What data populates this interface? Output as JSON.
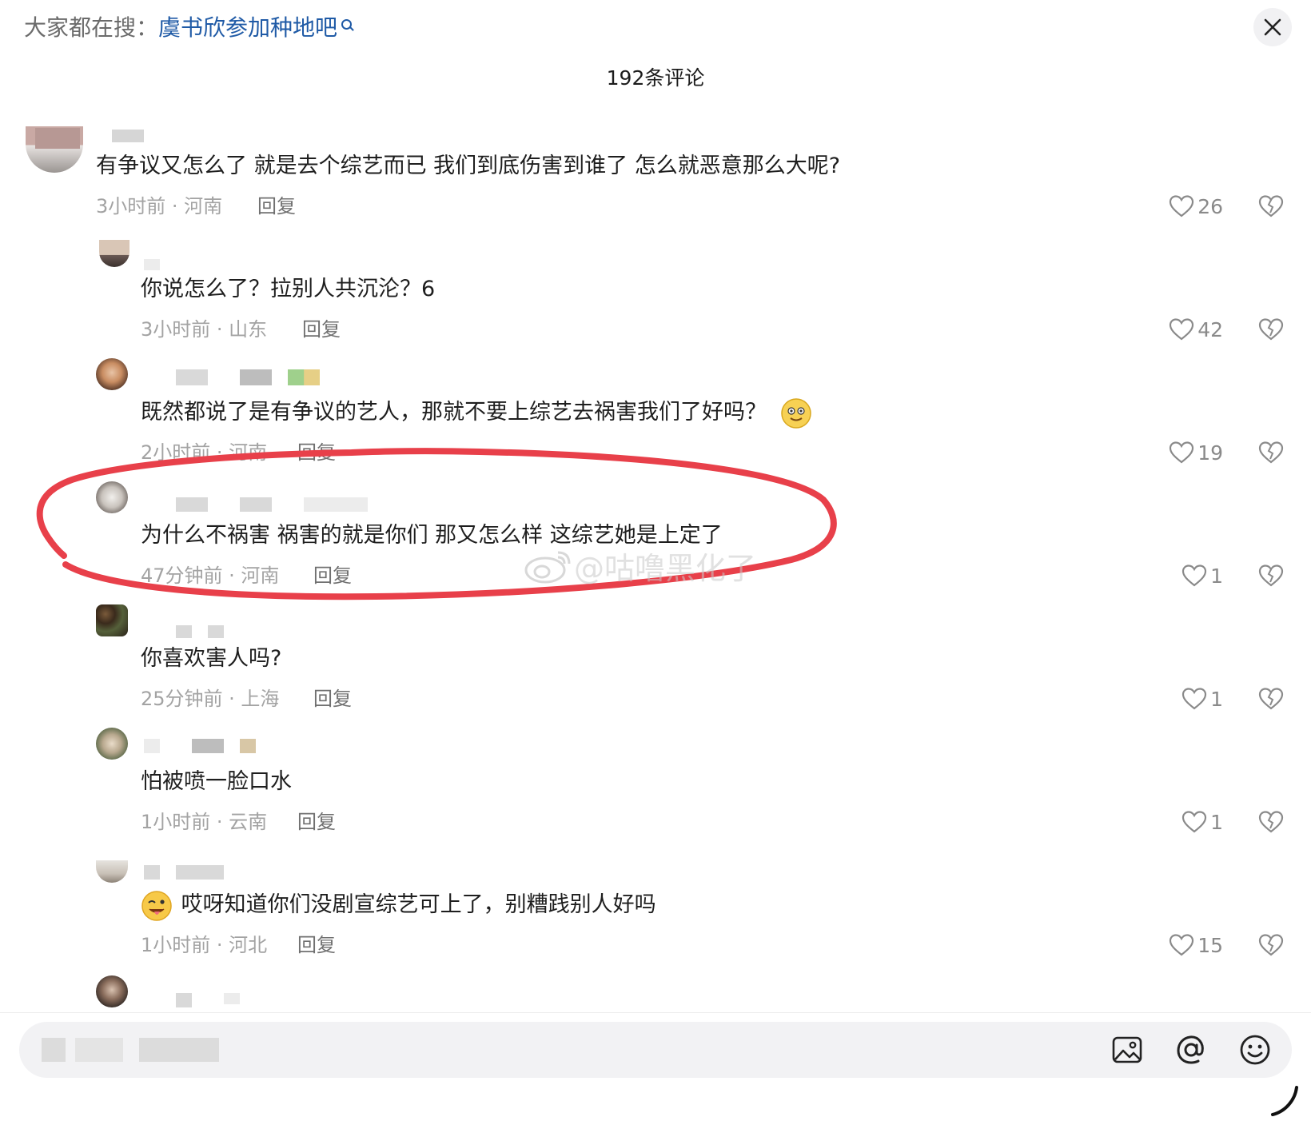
{
  "header": {
    "hot_search_prefix": "大家都在搜：",
    "hot_search_keyword": "虞书欣参加种地吧",
    "comment_count": "192条评论"
  },
  "comments": [
    {
      "text": "有争议又怎么了 就是去个综艺而已 我们到底伤害到谁了 怎么就恶意那么大呢?",
      "meta": "3小时前 · 河南",
      "reply": "回复",
      "likes": "26"
    },
    {
      "text": "你说怎么了？拉别人共沉沦？6",
      "meta": "3小时前 · 山东",
      "reply": "回复",
      "likes": "42"
    },
    {
      "text": "既然都说了是有争议的艺人，那就不要上综艺去祸害我们了好吗？",
      "meta": "2小时前 · 河南",
      "reply": "回复",
      "likes": "19"
    },
    {
      "text": "为什么不祸害 祸害的就是你们 那又怎么样  这综艺她是上定了",
      "meta": "47分钟前 · 河南",
      "reply": "回复",
      "likes": "1"
    },
    {
      "text": "你喜欢害人吗?",
      "meta": "25分钟前 · 上海",
      "reply": "回复",
      "likes": "1"
    },
    {
      "text": "怕被喷一脸口水",
      "meta": "1小时前 · 云南",
      "reply": "回复",
      "likes": "1"
    },
    {
      "text": "哎呀知道你们没剧宣综艺可上了，别糟践别人好吗",
      "meta": "1小时前 · 河北",
      "reply": "回复",
      "likes": "15"
    }
  ],
  "watermark": "@咕噜黑化了",
  "input_bar": {
    "value": "",
    "icons": [
      "image-icon",
      "at-icon",
      "emoji-icon"
    ]
  },
  "colors": {
    "keyword": "#1f5aa6",
    "highlight_circle": "#e8404a",
    "meta_text": "#a3a3a3",
    "comment_text": "#1e1e1e"
  }
}
